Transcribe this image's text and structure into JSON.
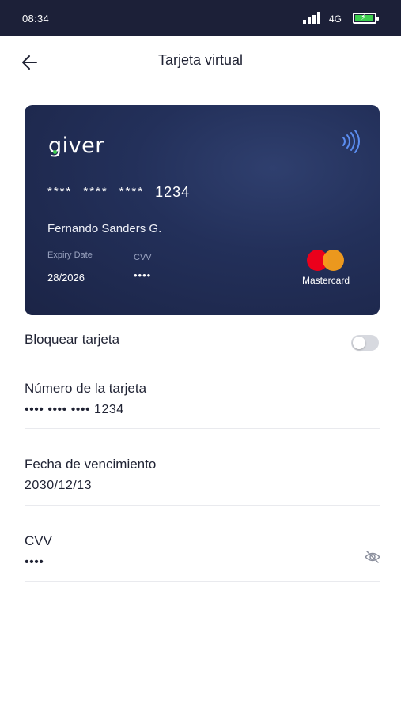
{
  "status_bar": {
    "time": "08:34",
    "network": "4G"
  },
  "header": {
    "title": "Tarjeta virtual",
    "back_icon": "arrow-left-icon"
  },
  "card": {
    "brand_logo": "giver",
    "masked_groups": [
      "****",
      "****",
      "****"
    ],
    "last_digits": "1234",
    "holder": "Fernando Sanders G.",
    "expiry_label": "Expiry Date",
    "expiry_value": "28/2026",
    "cvv_label": "CVV",
    "cvv_value": "••••",
    "network_label": "Mastercard",
    "contactless_icon": "contactless-icon"
  },
  "lock": {
    "label": "Bloquear tarjeta",
    "enabled": false
  },
  "fields": {
    "number": {
      "label": "Número de la tarjeta",
      "value": "•••• •••• •••• 1234"
    },
    "expiry": {
      "label": "Fecha de vencimiento",
      "value": "2030/12/13"
    },
    "cvv": {
      "label": "CVV",
      "value": "••••",
      "toggle_icon": "eye-off-icon"
    }
  },
  "colors": {
    "status_bar": "#1c2038",
    "card": "#23305a",
    "accent_green": "#3ecf4f",
    "mc_red": "#eb001b",
    "mc_yellow": "#f79e1b"
  }
}
